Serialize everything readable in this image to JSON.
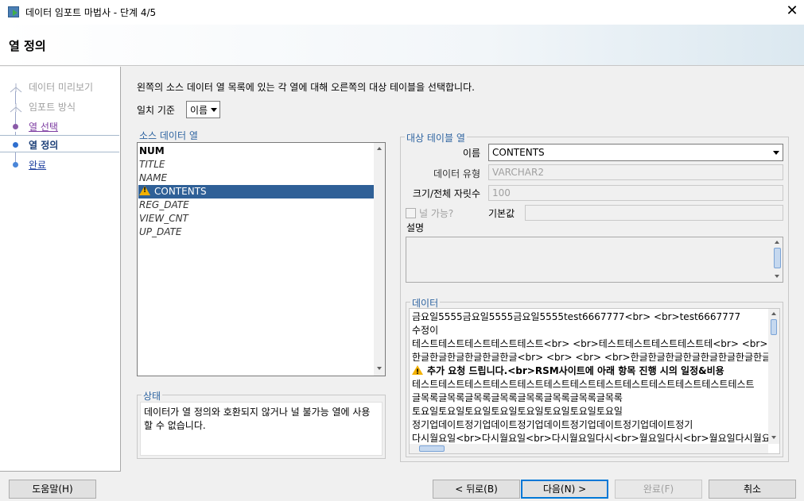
{
  "window": {
    "title": "데이터 임포트 마법사 - 단계 4/5"
  },
  "header": {
    "title": "열 정의"
  },
  "nav": {
    "items": [
      {
        "label": "데이터 미리보기",
        "state": "done"
      },
      {
        "label": "임포트 방식",
        "state": "done"
      },
      {
        "label": "열 선택",
        "state": "link"
      },
      {
        "label": "열 정의",
        "state": "current"
      },
      {
        "label": "완료",
        "state": "future"
      }
    ]
  },
  "main": {
    "instruction": "왼쪽의 소스 데이터 열 목록에 있는 각 열에 대해 오른쪽의 대상 테이블을 선택합니다.",
    "match_label": "일치 기준",
    "match_value": "이름",
    "source": {
      "legend": "소스 데이터 열",
      "columns": [
        "NUM",
        "TITLE",
        "NAME",
        "CONTENTS",
        "REG_DATE",
        "VIEW_CNT",
        "UP_DATE"
      ],
      "selected": "CONTENTS"
    },
    "status": {
      "legend": "상태",
      "text": "데이터가 열 정의와 호환되지 않거나 널 불가능 열에 사용할 수 없습니다."
    },
    "target": {
      "legend": "대상 테이블 열",
      "name_label": "이름",
      "name_value": "CONTENTS",
      "type_label": "데이터 유형",
      "type_value": "VARCHAR2",
      "size_label": "크기/전체 자릿수",
      "size_value": "100",
      "nullable_label": "널 가능?",
      "default_label": "기본값",
      "default_value": "",
      "description_label": "설명"
    },
    "data": {
      "legend": "데이터",
      "lines": [
        "금요일5555금요일5555금요일5555test6667777<br> <br>test6667777",
        "수정이",
        "테스트테스트테스트테스트테스트<br> <br>테스트테스트테스트테스트테<br> <br>테스트",
        "한글한글한글한글한글한글<br> <br> <br> <br>한글한글한글한글한글한글한글한글한글",
        "추가 요청 드립니다.<br>RSM사이트에 아래 항목 진행 시의 일정&비용 ",
        "테스트테스트테스트테스트테스트테스트테스트테스트테스트테스트테스트테스트테스트",
        "글목록글목록글목록글목록글목록글목록글목록글목록",
        "토요일토요일토요일토요일토요일토요일토요일토요일",
        "정기업데이트정기업데이트정기업데이트정기업데이트정기업데이트정기",
        "다시월요일<br>다시월요일<br>다시월요일다시<br>월요일다시<br>월요일다시월요일"
      ]
    }
  },
  "buttons": {
    "help": "도움말(H)",
    "back": "< 뒤로(B)",
    "next": "다음(N) >",
    "finish": "완료(F)",
    "cancel": "취소"
  }
}
